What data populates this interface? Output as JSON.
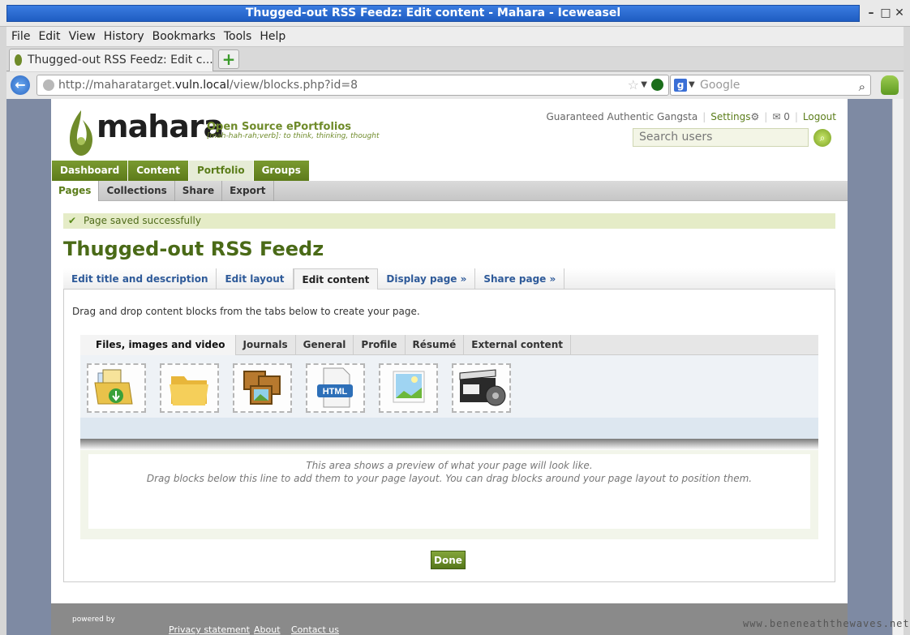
{
  "window": {
    "title": "Thugged-out RSS Feedz: Edit content - Mahara - Iceweasel"
  },
  "menu": [
    "File",
    "Edit",
    "View",
    "History",
    "Bookmarks",
    "Tools",
    "Help"
  ],
  "browser_tab": {
    "label": "Thugged-out RSS Feedz: Edit c..."
  },
  "urlbar": {
    "prefix": "http://maharatarget.",
    "host": "vuln.local",
    "path": "/view/blocks.php?id=8"
  },
  "searchbar": {
    "placeholder": "Google"
  },
  "header": {
    "logo_text": "mahara",
    "tagline": "Open Source ePortfolios",
    "tagline_sub": "[mah-hah-rah;verb]: to think, thinking, thought",
    "user_name": "Guaranteed Authentic Gangsta",
    "settings_label": "Settings",
    "inbox_count": "0",
    "logout_label": "Logout",
    "search_placeholder": "Search users"
  },
  "main_nav": [
    {
      "label": "Dashboard"
    },
    {
      "label": "Content"
    },
    {
      "label": "Portfolio"
    },
    {
      "label": "Groups"
    }
  ],
  "sub_nav": [
    {
      "label": "Pages"
    },
    {
      "label": "Collections"
    },
    {
      "label": "Share"
    },
    {
      "label": "Export"
    }
  ],
  "message": "Page saved successfully",
  "page_title": "Thugged-out RSS Feedz",
  "edit_tabs": [
    {
      "label": "Edit title and description"
    },
    {
      "label": "Edit layout"
    },
    {
      "label": "Edit content"
    },
    {
      "label": "Display page »"
    },
    {
      "label": "Share page »"
    }
  ],
  "instructions": "Drag and drop content blocks from the tabs below to create your page.",
  "category_tabs": [
    {
      "label": "Files, images and video"
    },
    {
      "label": "Journals"
    },
    {
      "label": "General"
    },
    {
      "label": "Profile"
    },
    {
      "label": "Résumé"
    },
    {
      "label": "External content"
    }
  ],
  "blocks": [
    {
      "icon": "file-download-icon"
    },
    {
      "icon": "folder-icon"
    },
    {
      "icon": "image-gallery-icon"
    },
    {
      "icon": "html-icon"
    },
    {
      "icon": "image-icon"
    },
    {
      "icon": "media-video-icon"
    }
  ],
  "preview": {
    "line1": "This area shows a preview of what your page will look like.",
    "line2": "Drag blocks below this line to add them to your page layout. You can drag blocks around your page layout to position them."
  },
  "done_label": "Done",
  "footer": {
    "powered_by": "powered by",
    "links": [
      "Privacy statement",
      "About",
      "Contact us"
    ]
  },
  "watermark": "www.beneneaththewaves.net",
  "colors": {
    "brand_green": "#5d7b1a",
    "title_blue": "#1f5dc2",
    "link_blue": "#2e5a99"
  }
}
